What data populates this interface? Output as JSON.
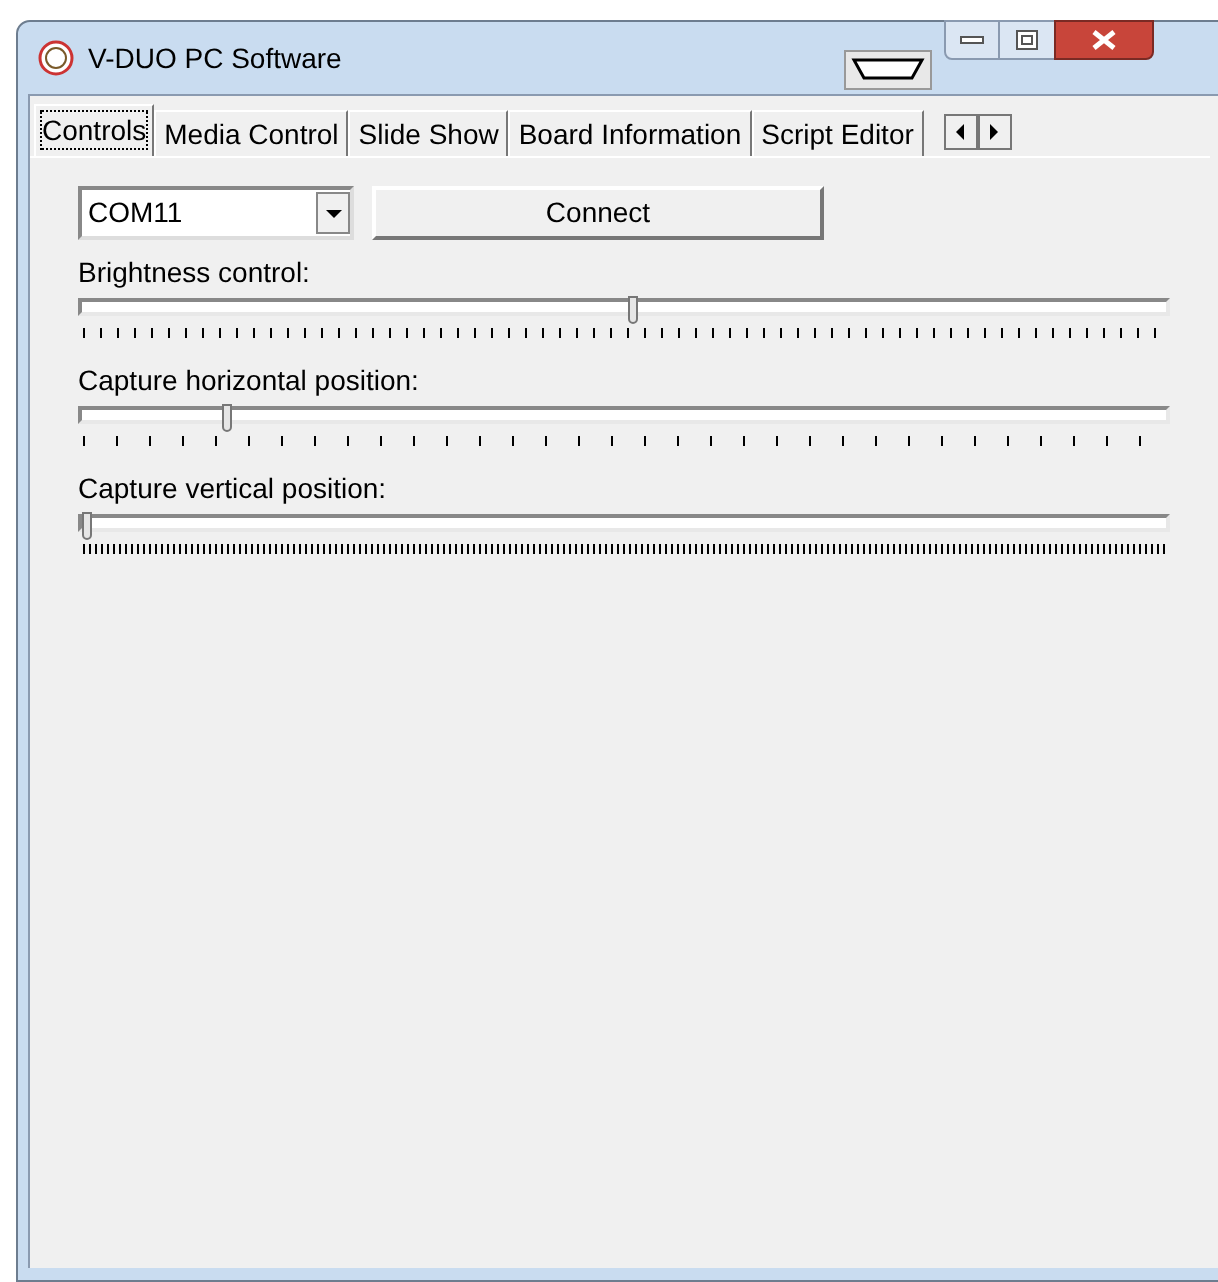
{
  "window": {
    "title": "V-DUO PC Software"
  },
  "tabs": [
    {
      "label": "Controls",
      "selected": true
    },
    {
      "label": "Media Control",
      "selected": false
    },
    {
      "label": "Slide Show",
      "selected": false
    },
    {
      "label": "Board Information",
      "selected": false
    },
    {
      "label": "Script Editor",
      "selected": false
    }
  ],
  "port": {
    "value": "COM11"
  },
  "connect_button": "Connect",
  "sliders": [
    {
      "label": "Brightness control:",
      "level": 0.51
    },
    {
      "label": "Capture horizontal position:",
      "level": 0.13
    },
    {
      "label": "Capture vertical position:",
      "level": 0.0
    }
  ]
}
